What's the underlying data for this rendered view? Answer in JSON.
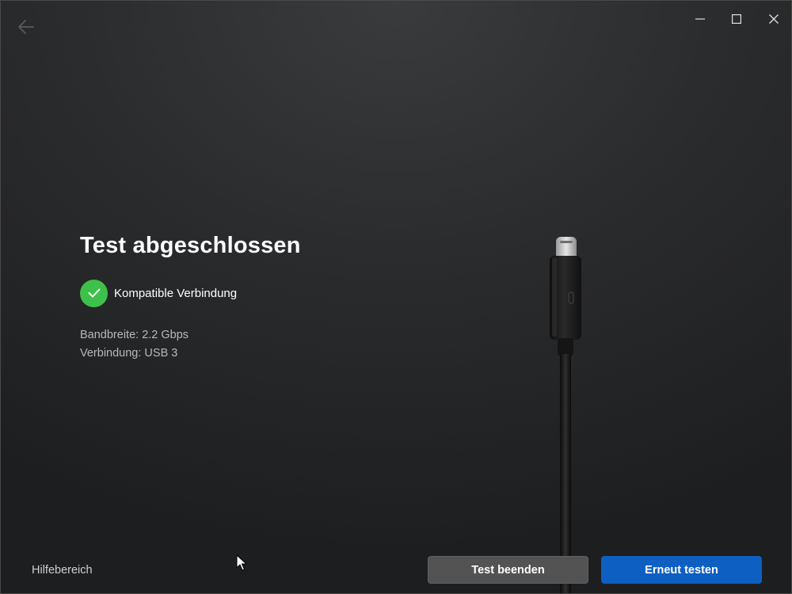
{
  "window": {
    "title": "",
    "controls": {
      "back_icon": "arrow-left-icon",
      "minimize_icon": "minimize-icon",
      "maximize_icon": "maximize-icon",
      "close_icon": "close-icon"
    }
  },
  "main": {
    "title": "Test abgeschlossen",
    "status": {
      "icon": "check-icon",
      "color": "#3ec14a",
      "text": "Kompatible Verbindung"
    },
    "details": {
      "bandwidth": "Bandbreite: 2.2 Gbps",
      "connection": "Verbindung: USB 3"
    },
    "illustration": "usb-c-cable-icon"
  },
  "footer": {
    "help_label": "Hilfebereich",
    "end_test_label": "Test beenden",
    "retest_label": "Erneut testen",
    "primary_color": "#0d5fc2"
  }
}
